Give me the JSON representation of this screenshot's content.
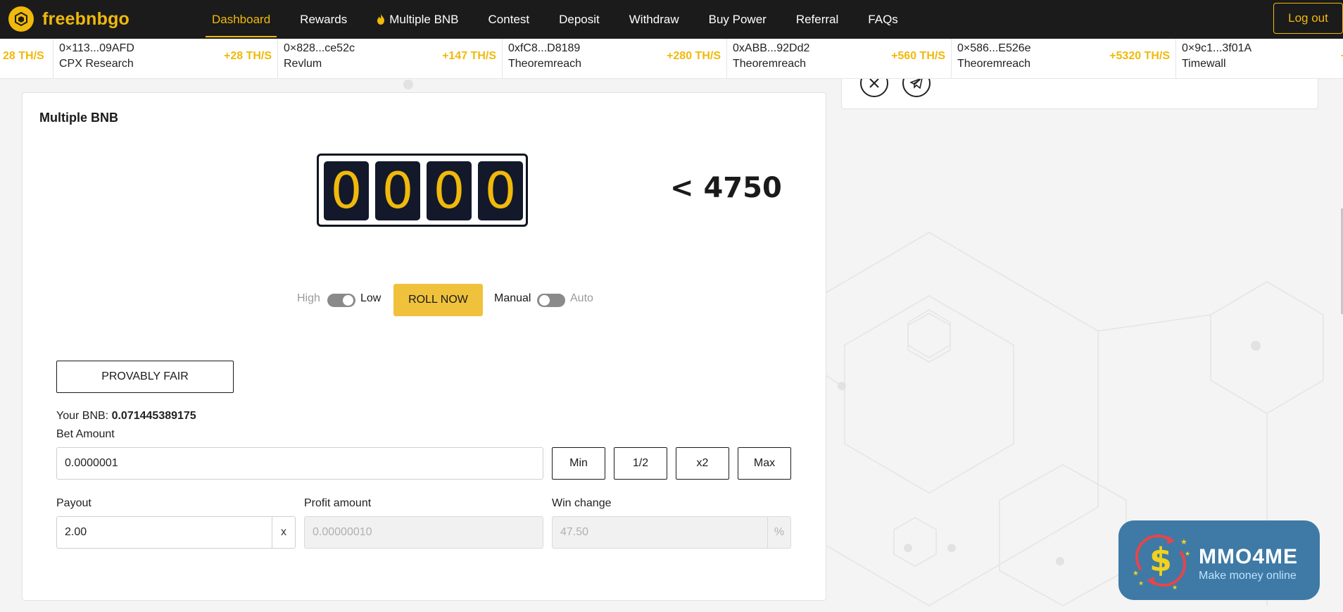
{
  "brand": {
    "name": "freebnbgo",
    "accent": "#f0b90b",
    "logo_icon": "bnb-cube-icon"
  },
  "nav": {
    "items": [
      {
        "label": "Dashboard",
        "active": true
      },
      {
        "label": "Rewards"
      },
      {
        "label": "Multiple BNB",
        "icon": "flame-icon"
      },
      {
        "label": "Contest"
      },
      {
        "label": "Deposit"
      },
      {
        "label": "Withdraw"
      },
      {
        "label": "Buy Power"
      },
      {
        "label": "Referral"
      },
      {
        "label": "FAQs"
      }
    ],
    "logout_label": "Log out"
  },
  "ticker": {
    "lead_gain": "28 TH/S",
    "items": [
      {
        "addr": "0×113...09AFD",
        "source": "CPX Research",
        "gain": "+28 TH/S"
      },
      {
        "addr": "0×828...ce52c",
        "source": "Revlum",
        "gain": "+147 TH/S"
      },
      {
        "addr": "0xfC8...D8189",
        "source": "Theoremreach",
        "gain": "+280 TH/S"
      },
      {
        "addr": "0xABB...92Dd2",
        "source": "Theoremreach",
        "gain": "+560 TH/S"
      },
      {
        "addr": "0×586...E526e",
        "source": "Theoremreach",
        "gain": "+5320 TH/S"
      },
      {
        "addr": "0×9c1...3f01A",
        "source": "Timewall",
        "gain": "+"
      }
    ]
  },
  "social": {
    "icons": [
      "x-icon",
      "telegram-icon"
    ]
  },
  "game": {
    "title": "Multiple BNB",
    "digits": [
      "0",
      "0",
      "0",
      "0"
    ],
    "target": "< 4750",
    "mode_high": "High",
    "mode_low": "Low",
    "mode_selected": "Low",
    "roll_label": "ROLL NOW",
    "manual_label": "Manual",
    "auto_label": "Auto",
    "roll_mode_selected": "Manual",
    "provably_fair_label": "PROVABLY FAIR",
    "balance_label": "Your BNB:",
    "balance_value": "0.071445389175",
    "bet_label": "Bet Amount",
    "bet_value": "0.0000001",
    "bet_buttons": [
      "Min",
      "1/2",
      "x2",
      "Max"
    ],
    "payout_label": "Payout",
    "payout_value": "2.00",
    "payout_suffix": "x",
    "profit_label": "Profit amount",
    "profit_value": "0.00000010",
    "win_label": "Win change",
    "win_value": "47.50",
    "win_suffix": "%"
  },
  "watermark": {
    "title": "MMO4ME",
    "subtitle": "Make money online",
    "icon": "dollar-cycle-icon"
  }
}
